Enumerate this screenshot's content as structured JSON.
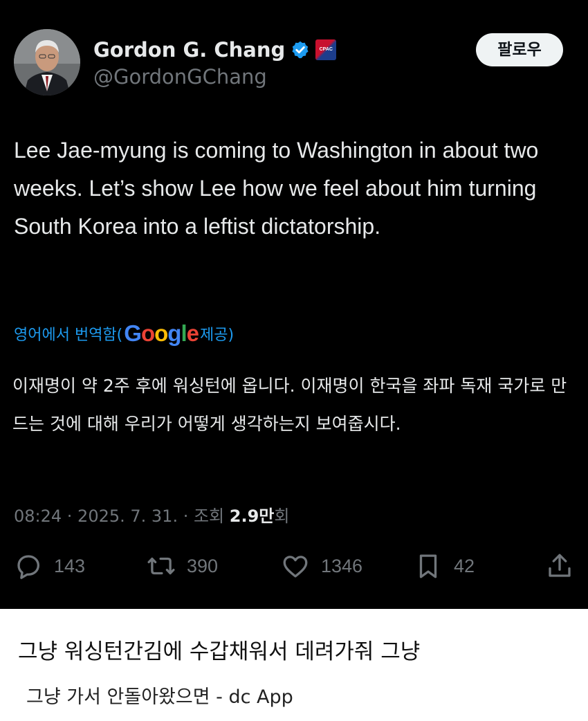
{
  "tweet": {
    "author_name": "Gordon G. Chang",
    "handle": "@GordonGChang",
    "follow_label": "팔로우",
    "badge_text": "CPAC",
    "text": "Lee Jae-myung is coming to Washington in about two weeks. Let’s show Lee how we feel about him turning South Korea into a leftist dictatorship.",
    "translation_prefix": "영어에서 번역함(",
    "translation_provider": "Google",
    "translation_suffix": " 제공)",
    "translated_text": "이재명이 약 2주 후에 워싱턴에 옵니다. 이재명이 한국을 좌파 독재 국가로 만드는 것에 대해 우리가 어떻게 생각하는지 보여줍시다.",
    "timestamp": "08:24 · 2025. 7. 31. · 조회 ",
    "views": "2.9만",
    "views_suffix": "회",
    "actions": {
      "replies": "143",
      "retweets": "390",
      "likes": "1346",
      "bookmarks": "42"
    },
    "colors": {
      "background": "#000000",
      "text": "#e7e9ea",
      "muted": "#71767b",
      "link": "#1d9bf0",
      "verified": "#1d9bf0"
    }
  },
  "comment": {
    "main": "그냥 워싱턴간김에 수갑채워서 데려가줘 그냥",
    "sub": "그냥 가서 안돌아왔으면 - dc App"
  }
}
